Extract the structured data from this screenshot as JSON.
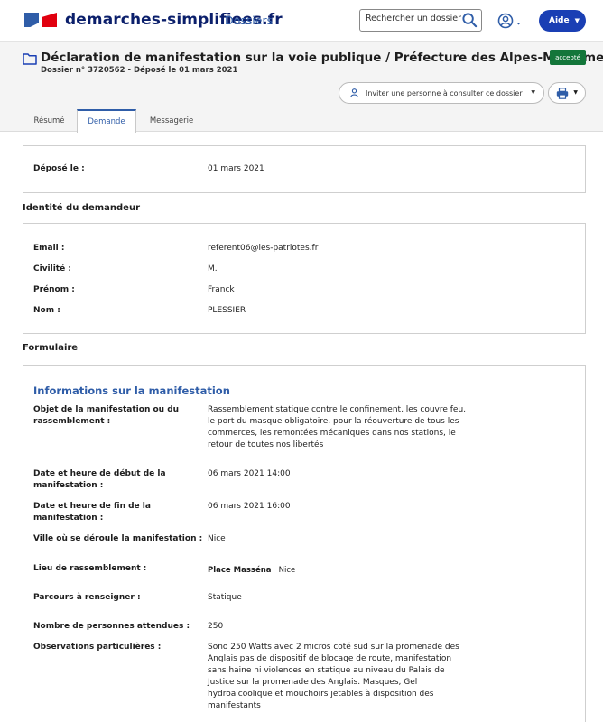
{
  "header": {
    "brand": "demarches-simplifiees.fr",
    "nav_dossiers": "Dossiers",
    "search_placeholder": "Rechercher un dossier",
    "help_label": "Aide"
  },
  "dossier": {
    "title": "Déclaration de manifestation sur la voie publique / Préfecture des Alpes-Maritimes",
    "subtitle": "Dossier n° 3720562 - Déposé le 01 mars 2021",
    "status": "accepté",
    "status_color": "#13763a",
    "invite_label": "Inviter une personne à consulter ce dossier",
    "tabs": [
      {
        "label": "Résumé",
        "active": false
      },
      {
        "label": "Demande",
        "active": true
      },
      {
        "label": "Messagerie",
        "active": false
      }
    ]
  },
  "deposit": {
    "label": "Déposé le :",
    "value": "01 mars 2021"
  },
  "identity": {
    "section_title": "Identité du demandeur",
    "fields": [
      {
        "label": "Email :",
        "value": "referent06@les-patriotes.fr"
      },
      {
        "label": "Civilité :",
        "value": "M."
      },
      {
        "label": "Prénom :",
        "value": "Franck"
      },
      {
        "label": "Nom :",
        "value": "PLESSIER"
      }
    ]
  },
  "form": {
    "section_title": "Formulaire",
    "heading": "Informations sur la manifestation",
    "fields": [
      {
        "label_lines": [
          "Objet de la manifestation ou du",
          "rassemblement :"
        ],
        "value_lines": [
          "Rassemblement statique contre le confinement, les couvre feu,",
          "le port du masque obligatoire, pour la réouverture de tous les",
          "commerces, les remontées mécaniques dans nos stations, le",
          "retour de toutes nos libertés"
        ]
      },
      {
        "label_lines": [
          "Date et heure de début de la",
          "manifestation :"
        ],
        "value_lines": [
          "06 mars 2021 14:00"
        ]
      },
      {
        "label_lines": [
          "Date et heure de fin de la",
          "manifestation :"
        ],
        "value_lines": [
          "06 mars 2021 16:00"
        ]
      },
      {
        "label_lines": [
          "Ville où se déroule la manifestation :"
        ],
        "value_lines": [
          "Nice"
        ]
      },
      {
        "label_lines": [
          "Lieu de rassemblement :"
        ],
        "value_parts": [
          "Place Masséna",
          "Nice"
        ]
      },
      {
        "label_lines": [
          "Parcours à renseigner :"
        ],
        "value_lines": [
          "Statique"
        ]
      },
      {
        "label_lines": [
          "Nombre de personnes attendues :"
        ],
        "value_lines": [
          "250"
        ]
      },
      {
        "label_lines": [
          "Observations particulières :"
        ],
        "value_lines": [
          "Sono 250 Watts avec 2 micros coté sud sur la promenade des",
          "Anglais pas de dispositif de blocage de route, manifestation",
          "sans haine ni violences en statique au niveau du Palais de",
          "Justice sur la promenade des Anglais. Masques, Gel",
          "hydroalcoolique et mouchoirs jetables à disposition des",
          "manifestants"
        ]
      }
    ]
  }
}
